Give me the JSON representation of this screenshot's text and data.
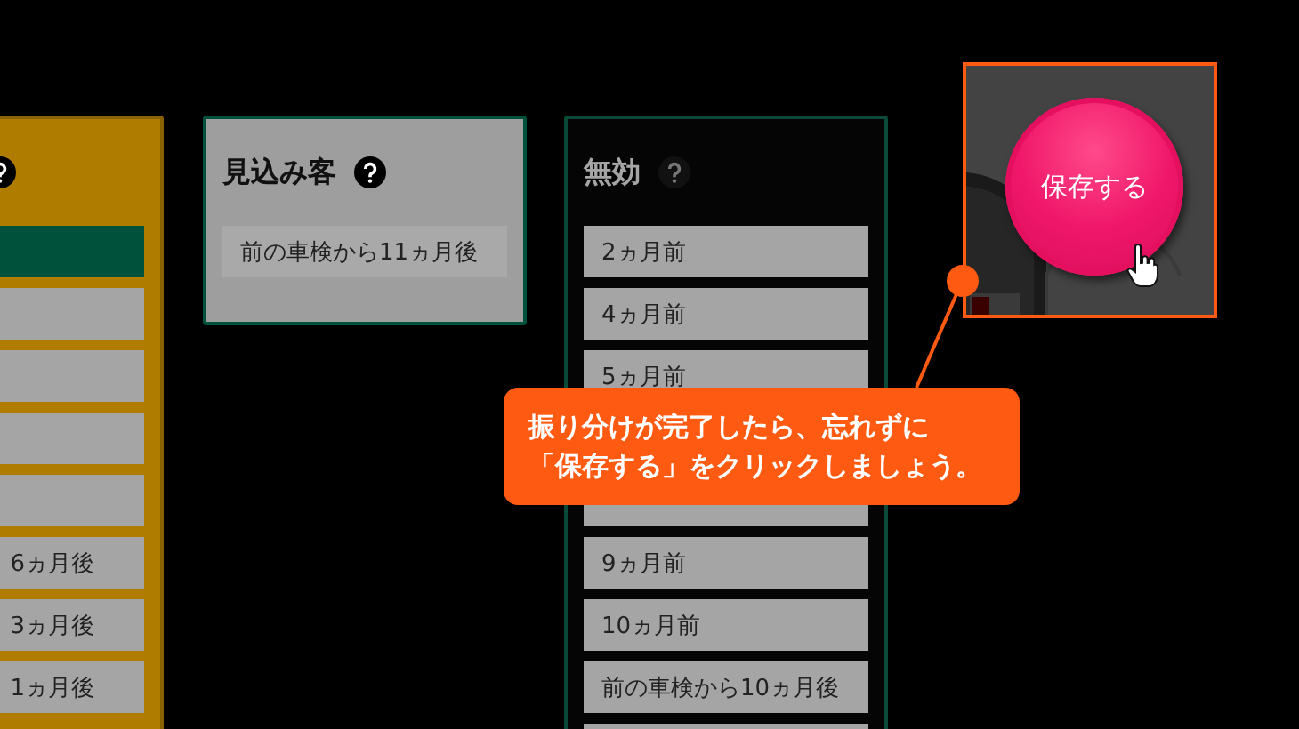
{
  "columns": [
    {
      "kind": "active",
      "items": [
        {
          "selected": true
        },
        {
          "selected": false
        },
        {
          "selected": false
        },
        {
          "selected": false
        },
        {
          "selected": false
        },
        {
          "label": "6ヵ月後",
          "selected": false
        },
        {
          "label": "3ヵ月後",
          "selected": false
        },
        {
          "label": "1ヵ月後",
          "selected": false
        }
      ]
    },
    {
      "kind": "prospect",
      "title": "見込み客",
      "items": [
        {
          "label": "前の車検から11ヵ月後",
          "selected": false
        }
      ]
    },
    {
      "kind": "invalid",
      "title": "無効",
      "items": [
        {
          "label": "2ヵ月前",
          "selected": false
        },
        {
          "label": "4ヵ月前",
          "selected": false
        },
        {
          "label": "5ヵ月前",
          "selected": false
        },
        {
          "selected": false
        },
        {
          "label": "9ヵ月前",
          "selected": false
        },
        {
          "label": "10ヵ月前",
          "selected": false
        },
        {
          "label": "前の車検から10ヵ月後",
          "selected": false
        },
        {
          "selected": false
        }
      ]
    }
  ],
  "save_button": {
    "label": "保存する"
  },
  "callout": {
    "lines": [
      "振り分けが完了したら、忘れずに",
      "「保存する」をクリックしましょう。"
    ]
  }
}
